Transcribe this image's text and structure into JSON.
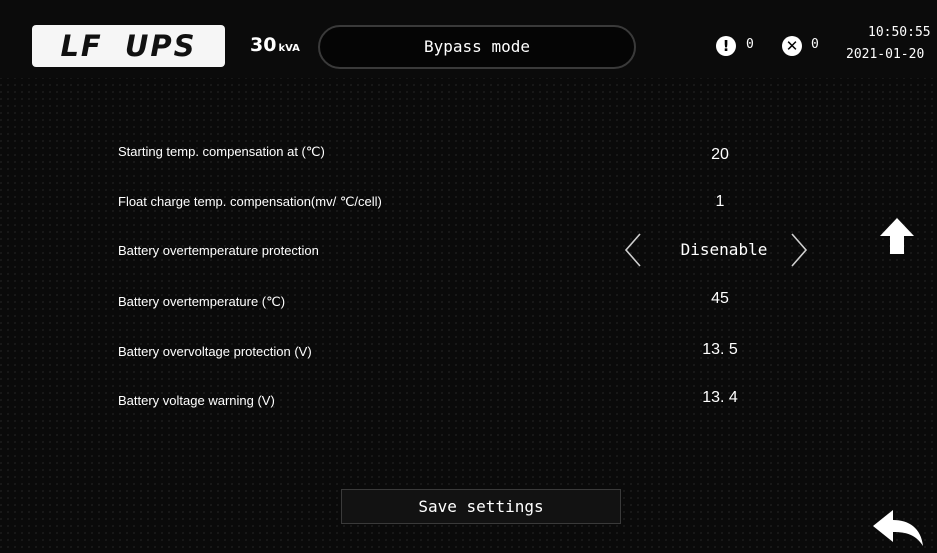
{
  "header": {
    "logo_text": "LF UPS",
    "power_value": "30",
    "power_unit": "kVA",
    "mode": "Bypass mode",
    "alarm_count": "0",
    "fault_count": "0",
    "time": "10:50:55",
    "date": "2021-01-20",
    "alarm_icon": "exclamation-icon",
    "fault_icon": "x-circle-icon"
  },
  "settings": [
    {
      "label": "Starting  temp. compensation at (℃)",
      "value": "20"
    },
    {
      "label": "Float charge temp. compensation(mv/  ℃/cell)",
      "value": "1"
    },
    {
      "label": "Battery overtemperature  protection",
      "value": "Disenable"
    },
    {
      "label": "Battery overtemperature  (℃)",
      "value": "45"
    },
    {
      "label": "Battery overvoltage protection (V)",
      "value": "13. 5"
    },
    {
      "label": "Battery voltage warning (V)",
      "value": "13. 4"
    }
  ],
  "buttons": {
    "save_label": "Save settings",
    "up_icon": "arrow-up-icon",
    "back_icon": "back-arrow-icon"
  },
  "colors": {
    "background": "#0a0a0a",
    "text": "#ffffff",
    "logo_bg": "#f6f6f6"
  }
}
